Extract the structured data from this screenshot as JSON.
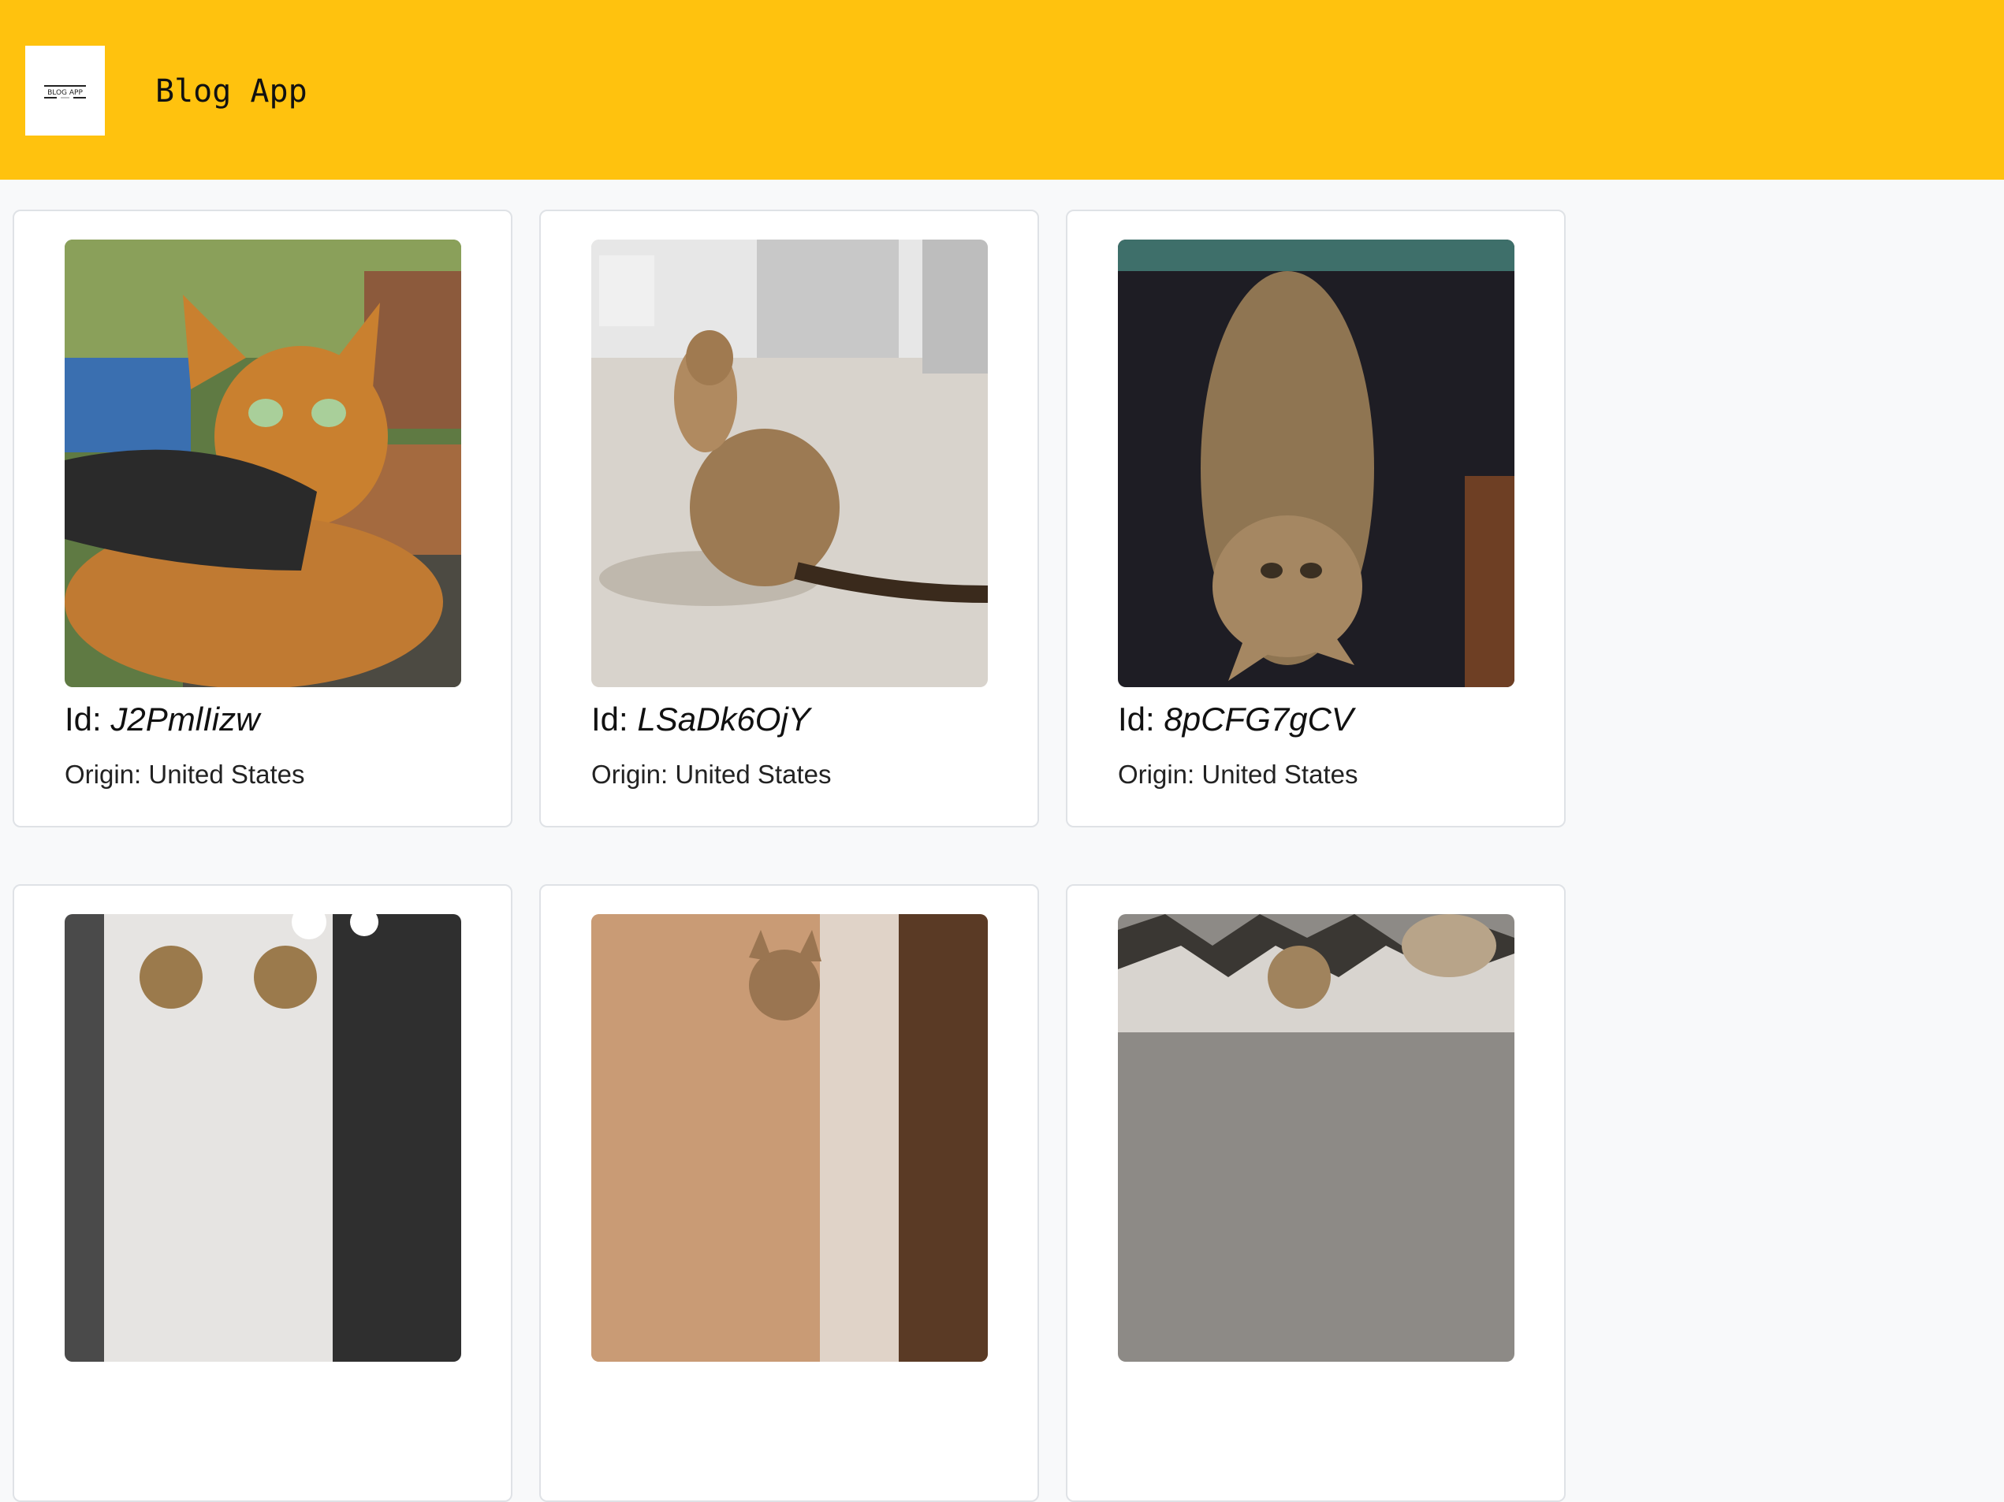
{
  "header": {
    "logo_text": "BLOG APP",
    "title": "Blog App",
    "background_color": "#ffc20e"
  },
  "posts": [
    {
      "id_label": "Id:",
      "id": "J2PmlIizw",
      "origin": "Origin: United States",
      "image": "bengal-cat-in-harness-outdoors"
    },
    {
      "id_label": "Id:",
      "id": "LSaDk6OjY",
      "origin": "Origin: United States",
      "image": "bengal-cat-sitting-on-floor"
    },
    {
      "id_label": "Id:",
      "id": "8pCFG7gCV",
      "origin": "Origin: United States",
      "image": "bengal-cat-upside-down-on-lap"
    },
    {
      "image": "two-bengal-cats-by-window"
    },
    {
      "image": "bengal-cat-in-doorway"
    },
    {
      "image": "bengal-cat-on-fur-blanket"
    }
  ]
}
